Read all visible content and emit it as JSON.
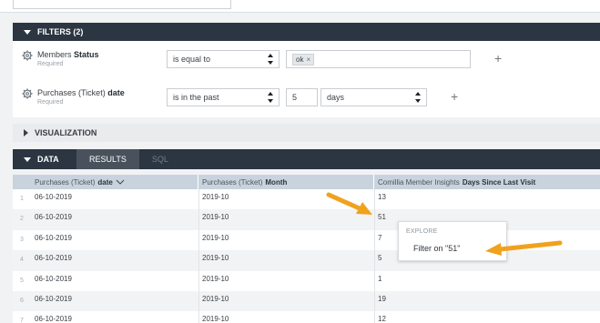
{
  "filters": {
    "title": "FILTERS (2)",
    "items": [
      {
        "field_view": "Members",
        "field_name": "Status",
        "required": "Required",
        "operator": "is equal to",
        "value_chip": "ok",
        "chip_remove": "×",
        "add": "+"
      },
      {
        "field_view": "Purchases (Ticket)",
        "field_name": "date",
        "required": "Required",
        "operator": "is in the past",
        "amount": "5",
        "unit": "days",
        "add": "+"
      }
    ]
  },
  "visualization": {
    "title": "VISUALIZATION"
  },
  "data": {
    "title": "DATA",
    "tabs": [
      {
        "label": "RESULTS",
        "active": true
      },
      {
        "label": "SQL",
        "active": false
      }
    ]
  },
  "table": {
    "columns": [
      {
        "view": "Purchases (Ticket)",
        "name": "date"
      },
      {
        "view": "Purchases (Ticket)",
        "name": "Month"
      },
      {
        "view": "Comillia Member Insights",
        "name": "Days Since Last Visit"
      }
    ],
    "rows": [
      {
        "n": "1",
        "date": "06-10-2019",
        "month": "2019-10",
        "days": "13"
      },
      {
        "n": "2",
        "date": "06-10-2019",
        "month": "2019-10",
        "days": "51"
      },
      {
        "n": "3",
        "date": "06-10-2019",
        "month": "2019-10",
        "days": "7"
      },
      {
        "n": "4",
        "date": "06-10-2019",
        "month": "2019-10",
        "days": "5"
      },
      {
        "n": "5",
        "date": "06-10-2019",
        "month": "2019-10",
        "days": "1"
      },
      {
        "n": "6",
        "date": "06-10-2019",
        "month": "2019-10",
        "days": "19"
      },
      {
        "n": "7",
        "date": "06-10-2019",
        "month": "2019-10",
        "days": "12"
      }
    ]
  },
  "explore_popup": {
    "header": "EXPLORE",
    "item": "Filter on \"51\""
  },
  "colors": {
    "header_bar": "#2c3542",
    "table_header": "#c9d3dd",
    "annotation_arrow": "#f0a21e"
  }
}
